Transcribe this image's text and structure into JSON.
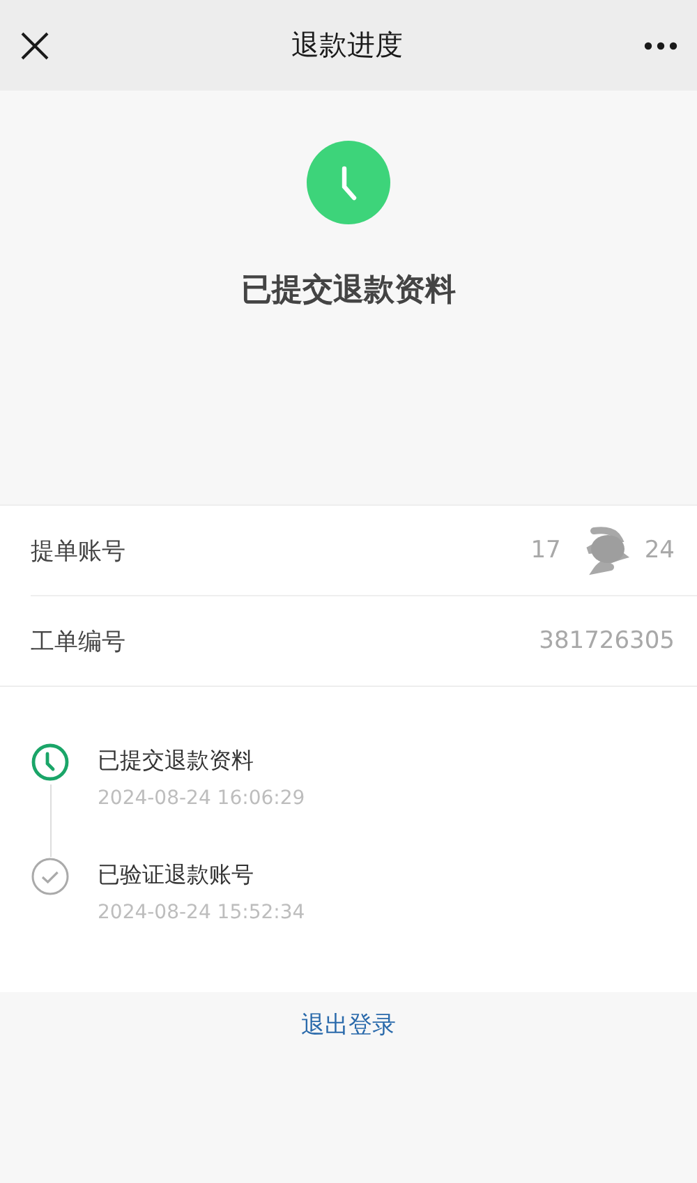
{
  "nav_bar": {
    "title": "退款进度"
  },
  "status": {
    "kind": "pending",
    "title": "已提交退款资料"
  },
  "info_rows": [
    {
      "label": "提单账号",
      "value": "17",
      "value_tail": "24",
      "redacted": true
    },
    {
      "label": "工单编号",
      "value": "381726305",
      "redacted": false
    }
  ],
  "timeline": [
    {
      "kind": "current",
      "title": "已提交退款资料",
      "time": "2024-08-24 16:06:29"
    },
    {
      "kind": "done",
      "title": "已验证退款账号",
      "time": "2024-08-24 15:52:34"
    }
  ],
  "logout_link": "退出登录"
}
